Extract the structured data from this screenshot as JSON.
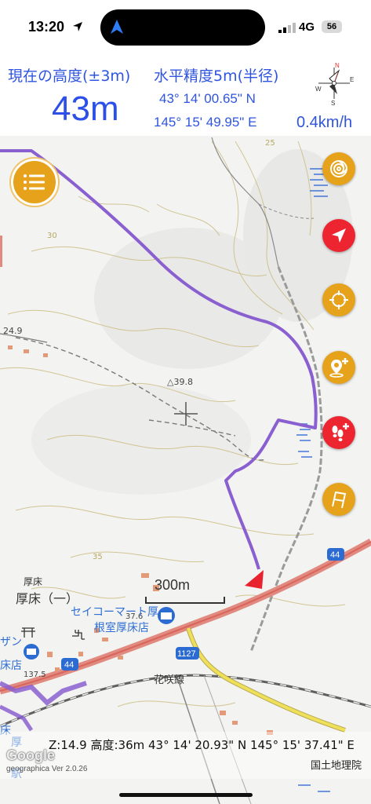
{
  "status": {
    "time": "13:20",
    "network": "4G",
    "battery": "56"
  },
  "info": {
    "altitude_label": "現在の高度(±3m)",
    "altitude_value": "43m",
    "accuracy_label": "水平精度5m(半径)",
    "latitude": "43° 14' 00.65\" N",
    "longitude": "145° 15' 49.95\" E",
    "speed": "0.4km/h",
    "compass_n": "N",
    "compass_s": "S",
    "compass_w": "W",
    "compass_e": "E"
  },
  "map": {
    "scale_label": "300m",
    "labels": {
      "elev_1": "24.9",
      "elev_2": "△39.8",
      "elev_3": "37.6",
      "elev_4": "137.5",
      "contour_25": "25",
      "contour_30": "30",
      "contour_35": "35",
      "place_small": "厚床",
      "place_main": "厚床（一）",
      "store_1": "セイコーマート厚",
      "store_2": "根室厚床店",
      "store_left_1": "ザン",
      "store_left_2": "床店",
      "route_44": "44",
      "route_44b": "44",
      "route_1127": "1127",
      "railway": "花咲線",
      "station_1": "床",
      "station_2": "厚",
      "station_3": "駅"
    },
    "colors": {
      "track": "#8a5fd0",
      "road_main": "#e06a60",
      "road_yellow": "#efe05a",
      "contour": "#c9b878"
    }
  },
  "bottom": {
    "info": "Z:14.9 高度:36m  43° 14' 20.93\" N 145° 15' 37.41\" E",
    "google": "Google",
    "version": "geographica Ver 2.0.26",
    "attribution": "国土地理院"
  },
  "buttons": {
    "menu": "menu-icon",
    "layers": "swirl-icon",
    "locate": "navigation-arrow-icon",
    "center": "crosshair-icon",
    "add_pin": "add-location-pin-icon",
    "add_footprint": "add-footprints-icon",
    "flag": "flag-icon"
  }
}
